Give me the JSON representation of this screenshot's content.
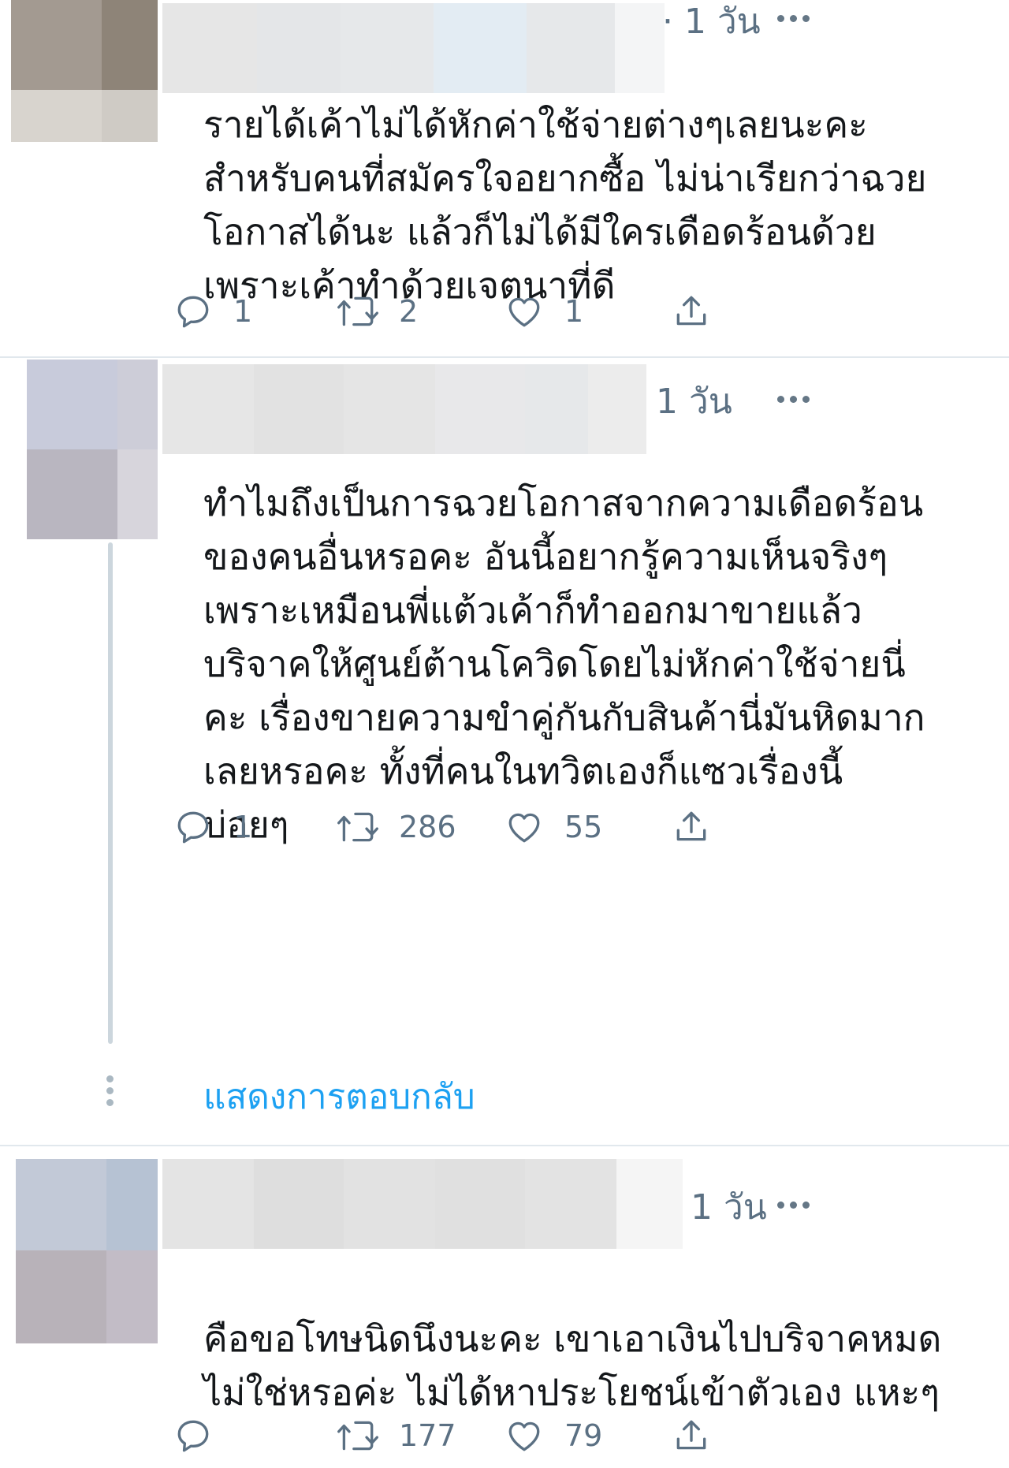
{
  "tweets": [
    {
      "time": "· 1 วัน",
      "text": "รายได้เค้าไม่ได้หักค่าใช้จ่ายต่างๆเลยนะคะ\nสำหรับคนที่สมัครใจอยากซื้อ ไม่น่าเรียกว่าฉวย\nโอกาสได้นะ แล้วก็ไม่ได้มีใครเดือดร้อนด้วย\nเพราะเค้าทำด้วยเจตนาที่ดี",
      "replies": "1",
      "retweets": "2",
      "likes": "1",
      "avatar_colors": [
        "#a39a91",
        "#8e8478",
        "#d8d4ce",
        "#cfcbc5"
      ],
      "namebar_colors": [
        "#e6e6e6",
        "#e4e6e8",
        "#e6e8ea",
        "#e3ecf3",
        "#e6e8ea",
        "#f4f5f6"
      ]
    },
    {
      "time": "1 วัน",
      "text": "ทำไมถึงเป็นการฉวยโอกาสจากความเดือดร้อน\nของคนอื่นหรอคะ อันนี้อยากรู้ความเห็นจริงๆ\nเพราะเหมือนพี่แต้วเค้าก็ทำออกมาขายแล้ว\nบริจาคให้ศูนย์ต้านโควิดโดยไม่หักค่าใช้จ่ายนี่\nคะ เรื่องขายความขำคู่กันกับสินค้านี่มันหิดมาก\nเลยหรอคะ ทั้งที่คนในทวิตเองก็แซวเรื่องนี้\nบ่อยๆ",
      "replies": "1",
      "retweets": "286",
      "likes": "55",
      "show_replies": "แสดงการตอบกลับ",
      "avatar_colors": [
        "#c8cbdb",
        "#cdcdd8",
        "#b9b6c0",
        "#d7d5dc"
      ],
      "namebar_colors": [
        "#e6e6e6",
        "#e2e2e2",
        "#e5e5e5",
        "#e8e8ea",
        "#e6e8ea",
        "#ececec"
      ]
    },
    {
      "time": "1 วัน",
      "text": "คือขอโทษนิดนึงนะคะ เขาเอาเงินไปบริจาคหมด\nไม่ใช่หรอค่ะ ไม่ได้หาประโยชน์เข้าตัวเอง แหะๆ",
      "replies": "",
      "retweets": "177",
      "likes": "79",
      "avatar_colors": [
        "#c2c9d7",
        "#b6c2d3",
        "#b8b2b9",
        "#c2bcc6"
      ],
      "namebar_colors": [
        "#e4e4e4",
        "#dedede",
        "#e2e2e2",
        "#e0e0e0",
        "#e3e3e3",
        "#f5f5f5"
      ]
    }
  ]
}
